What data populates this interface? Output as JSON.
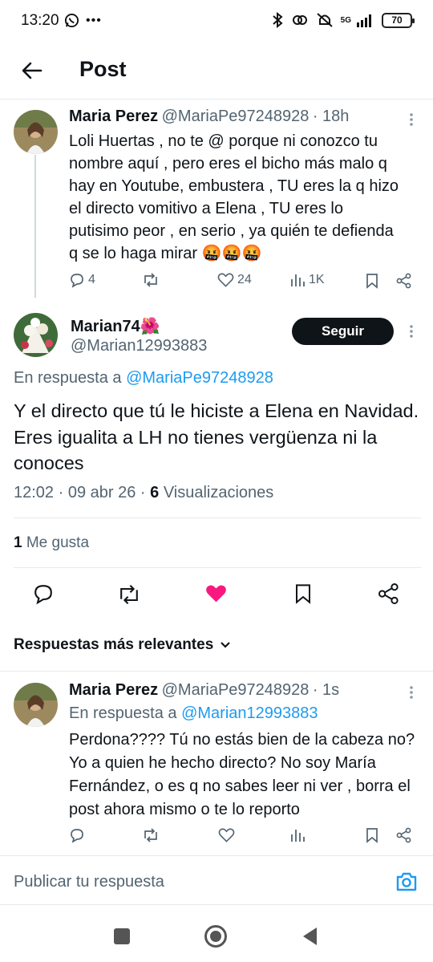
{
  "status_bar": {
    "time": "13:20",
    "network": "5G",
    "battery": "70"
  },
  "header": {
    "title": "Post"
  },
  "parent_tweet": {
    "name": "Maria Perez",
    "handle": "@MariaPe97248928",
    "time": "· 18h",
    "text_lines": [
      "Loli Huertas , no te @ porque ni conozco tu",
      "nombre aquí , pero eres el bicho más malo q",
      "hay en Youtube, embustera , TU eres la q hizo",
      "el directo vomitivo a Elena , TU eres lo",
      "putisimo peor , en serio , ya quién te defienda",
      "q se lo haga mirar 🤬🤬🤬"
    ],
    "replies": "4",
    "likes": "24",
    "views": "1K"
  },
  "main_tweet": {
    "name": "Marian74🌺",
    "handle": "@Marian12993883",
    "follow_label": "Seguir",
    "reply_to_prefix": "En respuesta a",
    "reply_to_handle": "@MariaPe97248928",
    "text": "Y el directo que tú le hiciste a Elena en Navidad. Eres igualita a LH no tienes vergüenza ni la conoces",
    "date": "12:02 · 09 abr 26 ·",
    "views_count": "6",
    "views_label": "Visualizaciones",
    "likes_count": "1",
    "likes_label": "Me gusta",
    "liked_color": "#f91880"
  },
  "replies_filter": {
    "label": "Respuestas más relevantes"
  },
  "reply_tweet": {
    "name": "Maria Perez",
    "handle": "@MariaPe97248928",
    "time": "· 1s",
    "reply_to_prefix": "En respuesta a",
    "reply_to_handle": "@Marian12993883",
    "text_lines": [
      "Perdona???? Tú no estás bien de la cabeza no?",
      "Yo a quien he hecho directo? No soy María",
      "Fernández, o es q no sabes leer ni ver , borra el",
      "post ahora mismo o te lo reporto"
    ]
  },
  "composer": {
    "placeholder": "Publicar tu respuesta"
  },
  "colors": {
    "accent": "#1d9bf0",
    "text": "#0f1419",
    "secondary": "#536471"
  }
}
